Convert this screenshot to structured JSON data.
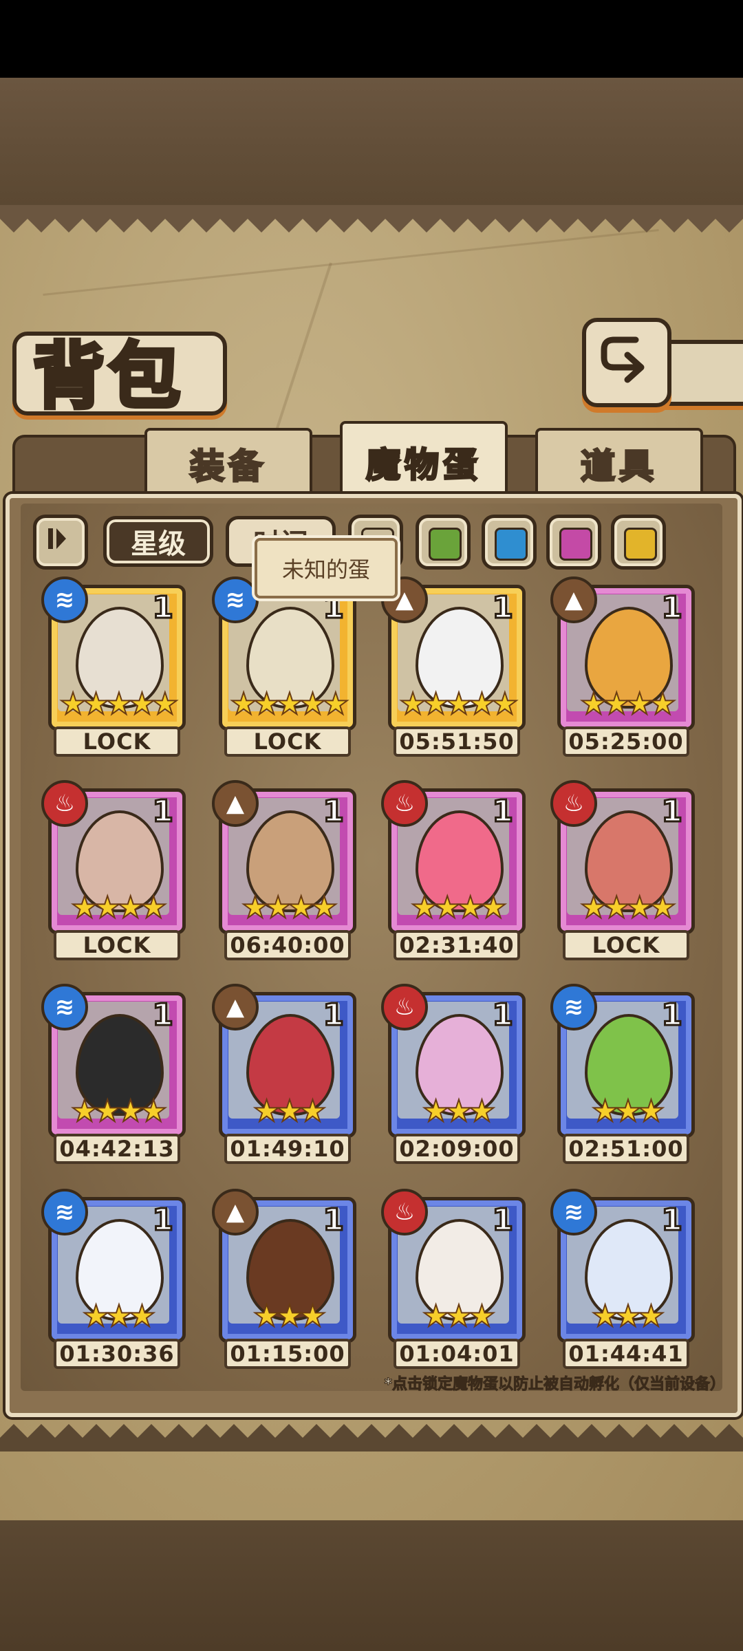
{
  "header": {
    "title": "背包"
  },
  "tabs": [
    {
      "label": "装备",
      "active": false
    },
    {
      "label": "魔物蛋",
      "active": true
    },
    {
      "label": "道具",
      "active": false
    }
  ],
  "filters": {
    "sort_star": "星级",
    "sort_time": "时间",
    "colors": [
      "#cdbf9e",
      "#6aa33a",
      "#2f8ed0",
      "#c44aa6",
      "#e2b42a"
    ]
  },
  "tooltip": "未知的蛋",
  "eggs": [
    {
      "count": "1",
      "stars": "★★★★★",
      "status": "LOCK",
      "element": "water",
      "frame": "gold",
      "egg_color": "#e7dfd2"
    },
    {
      "count": "1",
      "stars": "★★★★★",
      "status": "LOCK",
      "element": "water",
      "frame": "gold",
      "egg_color": "#e8dfc6"
    },
    {
      "count": "1",
      "stars": "★★★★★",
      "status": "05:51:50",
      "element": "earth",
      "frame": "gold",
      "egg_color": "#f2f2f2"
    },
    {
      "count": "1",
      "stars": "★★★★",
      "status": "05:25:00",
      "element": "earth",
      "frame": "pink",
      "egg_color": "#e9a640"
    },
    {
      "count": "1",
      "stars": "★★★★",
      "status": "LOCK",
      "element": "fire",
      "frame": "pink",
      "egg_color": "#d8b6a6"
    },
    {
      "count": "1",
      "stars": "★★★★",
      "status": "06:40:00",
      "element": "earth",
      "frame": "pink",
      "egg_color": "#c9a07a"
    },
    {
      "count": "1",
      "stars": "★★★★",
      "status": "02:31:40",
      "element": "fire",
      "frame": "pink",
      "egg_color": "#f06a8a"
    },
    {
      "count": "1",
      "stars": "★★★★",
      "status": "LOCK",
      "element": "fire",
      "frame": "pink",
      "egg_color": "#d8776a"
    },
    {
      "count": "1",
      "stars": "★★★★",
      "status": "04:42:13",
      "element": "water",
      "frame": "pink",
      "egg_color": "#2b2b2b"
    },
    {
      "count": "1",
      "stars": "★★★",
      "status": "01:49:10",
      "element": "earth",
      "frame": "blue",
      "egg_color": "#c43a44"
    },
    {
      "count": "1",
      "stars": "★★★",
      "status": "02:09:00",
      "element": "fire",
      "frame": "blue",
      "egg_color": "#e6b0d8"
    },
    {
      "count": "1",
      "stars": "★★★",
      "status": "02:51:00",
      "element": "water",
      "frame": "blue",
      "egg_color": "#7fc24a"
    },
    {
      "count": "1",
      "stars": "★★★",
      "status": "01:30:36",
      "element": "water",
      "frame": "blue",
      "egg_color": "#f2f4fa"
    },
    {
      "count": "1",
      "stars": "★★★",
      "status": "01:15:00",
      "element": "earth",
      "frame": "blue",
      "egg_color": "#6a3a22"
    },
    {
      "count": "1",
      "stars": "★★★",
      "status": "01:04:01",
      "element": "fire",
      "frame": "blue",
      "egg_color": "#f2ece6"
    },
    {
      "count": "1",
      "stars": "★★★",
      "status": "01:44:41",
      "element": "water",
      "frame": "blue",
      "egg_color": "#dfe8f8"
    }
  ],
  "footnote": "*点击锁定魔物蛋以防止被自动孵化（仅当前设备）"
}
